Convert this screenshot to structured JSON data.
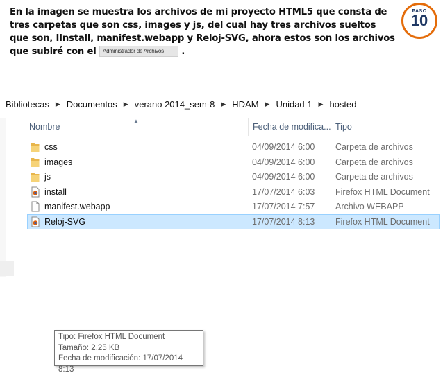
{
  "caption": {
    "line1": "En la imagen se muestra los archivos de mi proyecto HTML5 que consta de",
    "line2": "tres carpetas que son css, images y js, del cual hay tres archivos sueltos",
    "line3": "que son, IInstall, manifest.webapp y Reloj-SVG, ahora estos son los archivos",
    "line4_pre": "que subiré con el",
    "chip": "Administrador de Archivos",
    "line4_post": "."
  },
  "badge": {
    "label": "PASO",
    "number": "10",
    "color": "#e46c0a"
  },
  "breadcrumb": [
    "Bibliotecas",
    "Documentos",
    "verano 2014_sem-8",
    "HDAM",
    "Unidad 1",
    "hosted"
  ],
  "columns": {
    "name": "Nombre",
    "date": "Fecha de modifica...",
    "type": "Tipo"
  },
  "files": [
    {
      "name": "css",
      "date": "04/09/2014 6:00",
      "type": "Carpeta de archivos",
      "icon": "folder-icon"
    },
    {
      "name": "images",
      "date": "04/09/2014 6:00",
      "type": "Carpeta de archivos",
      "icon": "folder-icon"
    },
    {
      "name": "js",
      "date": "04/09/2014 6:00",
      "type": "Carpeta de archivos",
      "icon": "folder-icon"
    },
    {
      "name": "install",
      "date": "17/07/2014 6:03",
      "type": "Firefox HTML Document",
      "icon": "firefox-html-file-icon"
    },
    {
      "name": "manifest.webapp",
      "date": "17/07/2014 7:57",
      "type": "Archivo WEBAPP",
      "icon": "blank-file-icon"
    },
    {
      "name": "Reloj-SVG",
      "date": "17/07/2014 8:13",
      "type": "Firefox HTML Document",
      "icon": "firefox-html-file-icon",
      "selected": true
    }
  ],
  "tooltip": {
    "type": "Tipo: Firefox HTML Document",
    "size": "Tamaño: 2,25 KB",
    "modified": "Fecha de modificación: 17/07/2014 8:13"
  }
}
